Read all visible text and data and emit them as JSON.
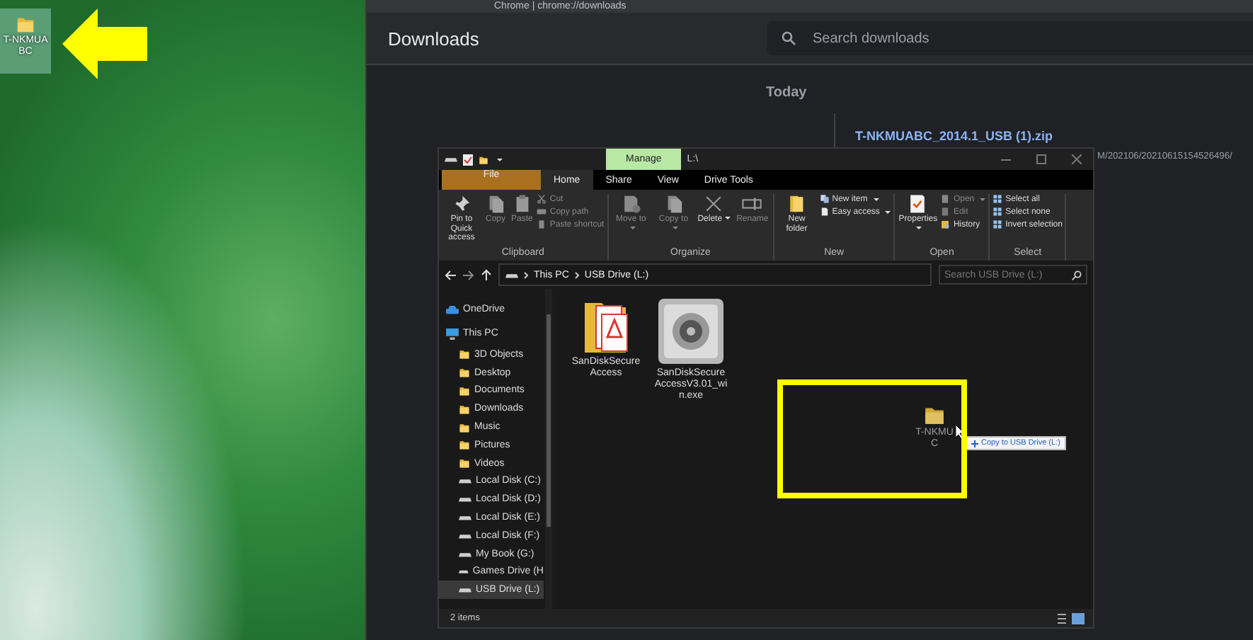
{
  "desktop": {
    "icon_label": "T-NKMUABC"
  },
  "browser": {
    "address": "Chrome | chrome://downloads",
    "page_title": "Downloads",
    "search": {
      "placeholder": "Search downloads"
    },
    "date_heading": "Today",
    "download": {
      "file_name": "T-NKMUABC_2014.1_USB (1).zip",
      "url": "M/202106/20210615154526496/"
    }
  },
  "explorer": {
    "context_tab": "Manage",
    "title": "L:\\",
    "tabs": [
      {
        "label": "File",
        "kind": "file",
        "selected": false
      },
      {
        "label": "Home",
        "kind": "tab",
        "selected": true
      },
      {
        "label": "Share",
        "kind": "tab",
        "selected": false
      },
      {
        "label": "View",
        "kind": "tab",
        "selected": false
      },
      {
        "label": "Drive Tools",
        "kind": "tab",
        "selected": false
      }
    ],
    "ribbon_groups": [
      {
        "label": "Clipboard",
        "items": [
          {
            "label": "Pin to Quick access",
            "kind": "large",
            "disabled": false,
            "menu": false
          },
          {
            "label": "Copy",
            "kind": "large",
            "disabled": true,
            "menu": false
          },
          {
            "label": "Paste",
            "kind": "large",
            "disabled": true,
            "menu": false
          },
          {
            "kind": "stack",
            "items": [
              {
                "label": "Cut",
                "disabled": true,
                "menu": false
              },
              {
                "label": "Copy path",
                "disabled": true,
                "menu": false
              },
              {
                "label": "Paste shortcut",
                "disabled": true,
                "menu": false
              }
            ]
          }
        ]
      },
      {
        "label": "Organize",
        "items": [
          {
            "label": "Move to",
            "kind": "large",
            "disabled": true,
            "menu": true
          },
          {
            "label": "Copy to",
            "kind": "large",
            "disabled": true,
            "menu": true
          },
          {
            "label": "Delete",
            "kind": "large",
            "disabled": false,
            "menu": true
          },
          {
            "label": "Rename",
            "kind": "large",
            "disabled": true,
            "menu": false
          }
        ]
      },
      {
        "label": "New",
        "items": [
          {
            "label": "New folder",
            "kind": "large",
            "disabled": false,
            "menu": false
          },
          {
            "kind": "stack",
            "items": [
              {
                "label": "New item",
                "disabled": false,
                "menu": true
              },
              {
                "label": "Easy access",
                "disabled": false,
                "menu": true
              }
            ]
          }
        ]
      },
      {
        "label": "Open",
        "items": [
          {
            "label": "Properties",
            "kind": "large",
            "disabled": false,
            "menu": true
          },
          {
            "kind": "stack",
            "items": [
              {
                "label": "Open",
                "disabled": true,
                "menu": true
              },
              {
                "label": "Edit",
                "disabled": true,
                "menu": false
              },
              {
                "label": "History",
                "disabled": false,
                "menu": false
              }
            ]
          }
        ]
      },
      {
        "label": "Select",
        "items": [
          {
            "kind": "stack",
            "items": [
              {
                "label": "Select all",
                "disabled": false,
                "menu": false
              },
              {
                "label": "Select none",
                "disabled": false,
                "menu": false
              },
              {
                "label": "Invert selection",
                "disabled": false,
                "menu": false
              }
            ]
          }
        ]
      }
    ],
    "address": {
      "crumbs": [
        "This PC",
        "USB Drive (L:)"
      ]
    },
    "search": {
      "placeholder": "Search USB Drive (L:)"
    },
    "nav": [
      {
        "label": "OneDrive",
        "kind": "cloud",
        "selected": false
      },
      {
        "label": "This PC",
        "kind": "pc",
        "selected": false,
        "children": [
          {
            "label": "3D Objects",
            "kind": "folder",
            "selected": false
          },
          {
            "label": "Desktop",
            "kind": "folder",
            "selected": false
          },
          {
            "label": "Documents",
            "kind": "folder",
            "selected": false
          },
          {
            "label": "Downloads",
            "kind": "folder",
            "selected": false
          },
          {
            "label": "Music",
            "kind": "folder",
            "selected": false
          },
          {
            "label": "Pictures",
            "kind": "folder",
            "selected": false
          },
          {
            "label": "Videos",
            "kind": "folder",
            "selected": false
          },
          {
            "label": "Local Disk (C:)",
            "kind": "drive",
            "selected": false
          },
          {
            "label": "Local Disk (D:)",
            "kind": "drive",
            "selected": false
          },
          {
            "label": "Local Disk (E:)",
            "kind": "drive",
            "selected": false
          },
          {
            "label": "Local Disk (F:)",
            "kind": "drive",
            "selected": false
          },
          {
            "label": "My Book (G:)",
            "kind": "drive",
            "selected": false
          },
          {
            "label": "Games Drive (H",
            "kind": "drive",
            "selected": false
          },
          {
            "label": "USB Drive (L:)",
            "kind": "drive",
            "selected": true
          }
        ]
      }
    ],
    "files": [
      {
        "name": "SanDiskSecureAccess",
        "kind": "pdf-folder"
      },
      {
        "name": "SanDiskSecureAccessV3.01_win.exe",
        "kind": "safe"
      }
    ],
    "drag": {
      "label_lines": [
        "T-NKMU",
        "C"
      ],
      "tooltip": "Copy to USB Drive (L:)"
    },
    "status": "2 items"
  }
}
